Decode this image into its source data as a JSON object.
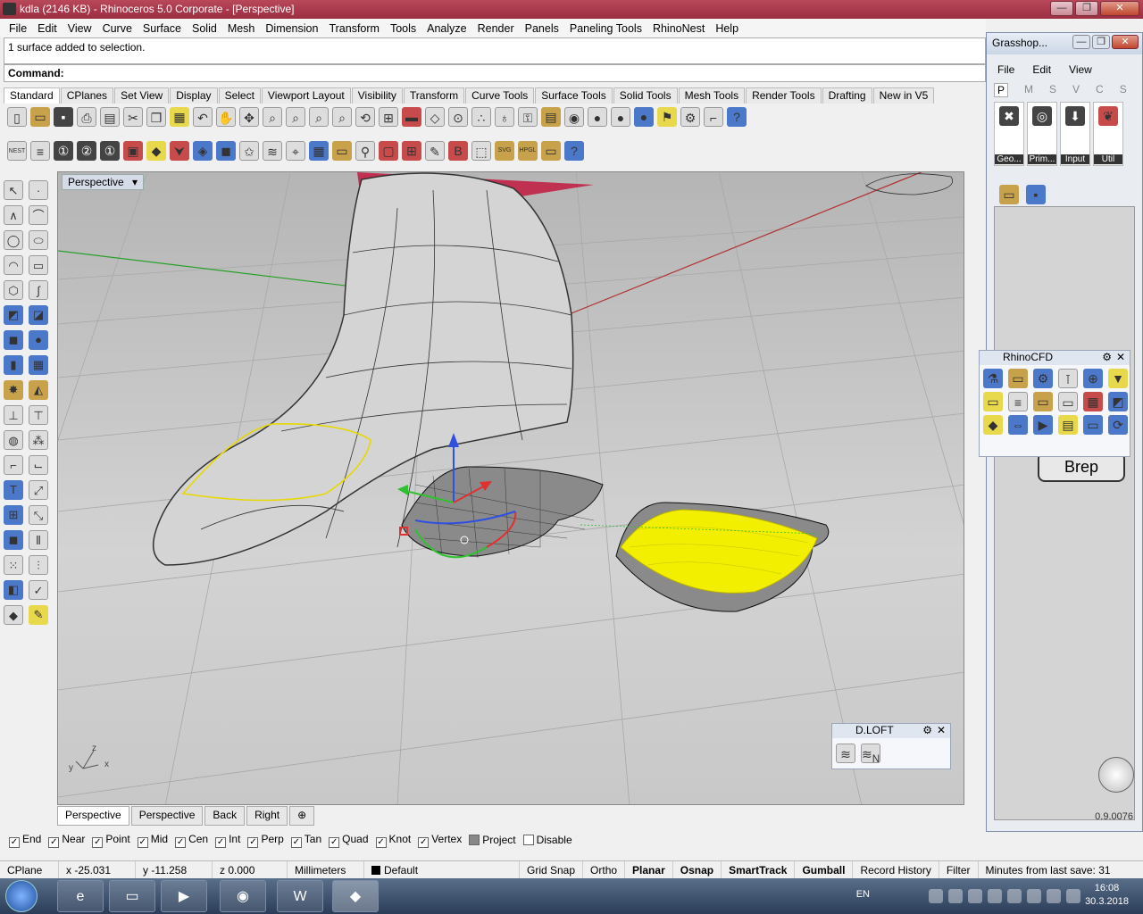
{
  "window": {
    "title": "kdla (2146 KB) - Rhinoceros  5.0 Corporate - [Perspective]",
    "min": "—",
    "max": "❐",
    "close": "✕"
  },
  "menu": [
    "File",
    "Edit",
    "View",
    "Curve",
    "Surface",
    "Solid",
    "Mesh",
    "Dimension",
    "Transform",
    "Tools",
    "Analyze",
    "Render",
    "Panels",
    "Paneling Tools",
    "RhinoNest",
    "Help"
  ],
  "command": {
    "history": "1 surface added to selection.",
    "prompt": "Command:"
  },
  "toolbar_tabs": [
    "Standard",
    "CPlanes",
    "Set View",
    "Display",
    "Select",
    "Viewport Layout",
    "Visibility",
    "Transform",
    "Curve Tools",
    "Surface Tools",
    "Solid Tools",
    "Mesh Tools",
    "Render Tools",
    "Drafting",
    "New in V5"
  ],
  "toolbar2": {
    "nest": "NEST",
    "svg": "SVG",
    "hpgl": "HPGL"
  },
  "viewport": {
    "label": "Perspective",
    "axes": {
      "z": "z",
      "y": "y",
      "x": "x"
    }
  },
  "viewport_tabs": [
    "Perspective",
    "Perspective",
    "Back",
    "Right"
  ],
  "osnaps": [
    {
      "label": "End",
      "checked": true
    },
    {
      "label": "Near",
      "checked": true
    },
    {
      "label": "Point",
      "checked": true
    },
    {
      "label": "Mid",
      "checked": true
    },
    {
      "label": "Cen",
      "checked": true
    },
    {
      "label": "Int",
      "checked": true
    },
    {
      "label": "Perp",
      "checked": true
    },
    {
      "label": "Tan",
      "checked": true
    },
    {
      "label": "Quad",
      "checked": true
    },
    {
      "label": "Knot",
      "checked": true
    },
    {
      "label": "Vertex",
      "checked": true
    },
    {
      "label": "Project",
      "checked": false
    },
    {
      "label": "Disable",
      "checked": false
    }
  ],
  "status": {
    "cplane": "CPlane",
    "x": "x -25.031",
    "y": "y -11.258",
    "z": "z 0.000",
    "units": "Millimeters",
    "layer": "Default",
    "grid_snap": "Grid Snap",
    "ortho": "Ortho",
    "planar": "Planar",
    "osnap": "Osnap",
    "smarttrack": "SmartTrack",
    "gumball": "Gumball",
    "record_history": "Record History",
    "filter": "Filter",
    "minutes": "Minutes from last save: 31"
  },
  "grasshopper": {
    "title": "Grasshop...",
    "menu": [
      "File",
      "Edit",
      "View"
    ],
    "tabs": [
      "P",
      "M",
      "S",
      "V",
      "C",
      "S"
    ],
    "categories": [
      "Geo...",
      "Prim...",
      "Input",
      "Util"
    ],
    "version": "0.9.0076",
    "component": "Brep"
  },
  "rhinocfd": {
    "title": "RhinoCFD"
  },
  "dloft": {
    "title": "D.LOFT",
    "n": "N"
  },
  "taskbar": {
    "lang": "EN",
    "time": "16:08",
    "date": "30.3.2018"
  },
  "colors": {
    "titlebar": "#a83a4e",
    "selection_yellow": "#f2f000",
    "gumball_red": "#e03030",
    "gumball_green": "#30c030",
    "gumball_blue": "#3050e0"
  }
}
